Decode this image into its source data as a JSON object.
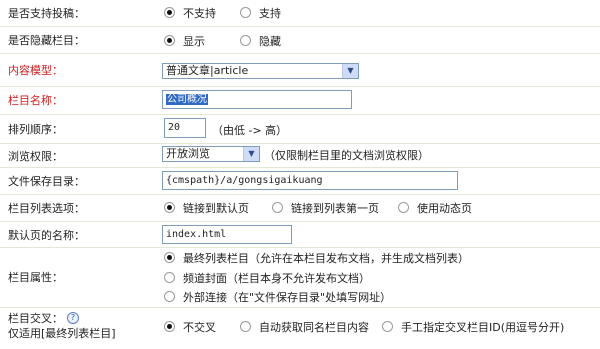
{
  "rows": {
    "submit": {
      "label": "是否支持投稿：",
      "options": [
        "不支持",
        "支持"
      ],
      "selected": 0
    },
    "hidden": {
      "label": "是否隐藏栏目：",
      "options": [
        "显示",
        "隐藏"
      ],
      "selected": 0
    },
    "model": {
      "label": "内容模型：",
      "value": "普通文章|article"
    },
    "name": {
      "label": "栏目名称：",
      "value": "公司概况"
    },
    "sort": {
      "label": "排列顺序：",
      "value": "20",
      "hint": "（由低 -> 高）"
    },
    "browse": {
      "label": "浏览权限：",
      "value": "开放浏览",
      "hint": "（仅限制栏目里的文档浏览权限）"
    },
    "savedir": {
      "label": "文件保存目录：",
      "value": "{cmspath}/a/gongsigaikuang"
    },
    "listopt": {
      "label": "栏目列表选项：",
      "options": [
        "链接到默认页",
        "链接到列表第一页",
        "使用动态页"
      ],
      "selected": 0
    },
    "defaultpage": {
      "label": "默认页的名称：",
      "value": "index.html"
    },
    "attr": {
      "label": "栏目属性：",
      "options": [
        "最终列表栏目（允许在本栏目发布文档，并生成文档列表）",
        "频道封面（栏目本身不允许发布文档）",
        "外部连接（在\"文件保存目录\"处填写网址）"
      ],
      "selected": 0
    },
    "cross": {
      "label": "栏目交叉：",
      "help": "?",
      "sublabel": "仅适用[最终列表栏目]",
      "options": [
        "不交叉",
        "自动获取同名栏目内容",
        "手工指定交叉栏目ID(用逗号分开)"
      ],
      "selected": 0
    }
  },
  "colors": {
    "required_label": "#d02020",
    "row_border": "#e3e8d6",
    "highlight": "#316ac5"
  },
  "icons": {
    "dropdown": "chevron-down-icon",
    "help": "help-icon"
  }
}
